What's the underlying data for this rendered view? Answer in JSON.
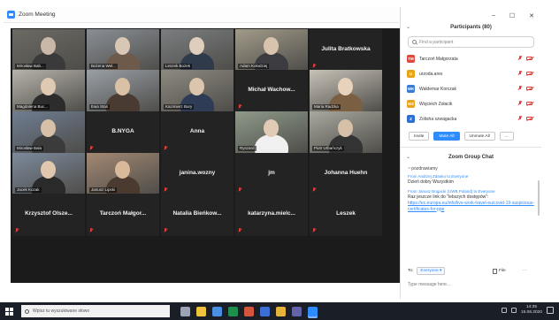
{
  "window": {
    "title": "Zoom Meeting"
  },
  "gallery": {
    "tiles": [
      {
        "name": "Mirosław Bab...",
        "type": "video"
      },
      {
        "name": "Bożena Wel...",
        "type": "video"
      },
      {
        "name": "Leszek Bożek",
        "type": "video"
      },
      {
        "name": "Adam Kołodziej",
        "type": "video",
        "active": true
      },
      {
        "name": "Julita Bratkowska",
        "type": "name"
      },
      {
        "name": "Magdalena Buc...",
        "type": "video"
      },
      {
        "name": "Ewa Staś",
        "type": "video"
      },
      {
        "name": "Kazimierz Bury",
        "type": "video"
      },
      {
        "name": "Michał Wachow...",
        "type": "name"
      },
      {
        "name": "Maria Radzka",
        "type": "video"
      },
      {
        "name": "Mirosław Bala",
        "type": "video"
      },
      {
        "name": "B.NYGA",
        "type": "name"
      },
      {
        "name": "Anna",
        "type": "name"
      },
      {
        "name": "Ryszard",
        "type": "video"
      },
      {
        "name": "Piotr Urbańczyk",
        "type": "video"
      },
      {
        "name": "Jacek Kozak",
        "type": "video"
      },
      {
        "name": "Janusz Lipski",
        "type": "video"
      },
      {
        "name": "janina.wozny",
        "type": "name"
      },
      {
        "name": "jm",
        "type": "name"
      },
      {
        "name": "Johanna Huehn",
        "type": "name"
      },
      {
        "name": "Krzysztof Olsze...",
        "type": "name"
      },
      {
        "name": "Tarczoń Małgor...",
        "type": "name"
      },
      {
        "name": "Natalia Bieńkow...",
        "type": "name"
      },
      {
        "name": "katarzyna.mielc...",
        "type": "name"
      },
      {
        "name": "Leszek",
        "type": "name"
      }
    ]
  },
  "participants": {
    "header": "Participants (80)",
    "collapse_glyph": "⌄",
    "search_placeholder": "Find a participant",
    "list": [
      {
        "initials": "TM",
        "name": "Tarczoń Małgorzata",
        "color": "#e0483e"
      },
      {
        "initials": "U",
        "name": "urzoda.ares",
        "color": "#e8a317"
      },
      {
        "initials": "WK",
        "name": "Waldemar Korczak",
        "color": "#3a7bd5"
      },
      {
        "initials": "WZ",
        "name": "Wojciech Zołacik",
        "color": "#e8a317"
      },
      {
        "initials": "Z",
        "name": "Zolisha szwagacka",
        "color": "#2d6fd1"
      }
    ],
    "buttons": {
      "invite": "Invite",
      "mute_all": "Mute All",
      "unmute_all": "Unmute All",
      "more": "..."
    }
  },
  "chat": {
    "header": "Zoom Group Chat",
    "messages": [
      {
        "from": "",
        "text": "~ pozdrawiamy"
      },
      {
        "from": "From Andrzej Zdanko to Everyone",
        "text": "Dzień dobry Wszystkim"
      },
      {
        "from": "From Janusz Bogacki (UWB Poland) to Everyone",
        "text": "Raz jeszcze link do \"lebszych dostępów\":",
        "link": "https://ec.europa.eu/info/live-work-travel-eu/covid-19-suspicious-certificates-for-ppe"
      }
    ],
    "to_label": "To:",
    "to_value": "Everyone ▾",
    "file_label": "File",
    "more_glyph": "···",
    "input_placeholder": "Type message here..."
  },
  "taskbar": {
    "search_placeholder": "Wpisz tu wyszukiwane słowo",
    "time": "14:35",
    "date": "15.06.2020",
    "apps": [
      {
        "name": "task-view",
        "color": "#9aa4b5"
      },
      {
        "name": "file-explorer",
        "color": "#f0c33c"
      },
      {
        "name": "store",
        "color": "#4a90e2"
      },
      {
        "name": "excel",
        "color": "#1f8f4e"
      },
      {
        "name": "powerpoint",
        "color": "#d2553c"
      },
      {
        "name": "word",
        "color": "#3b6fd6"
      },
      {
        "name": "chrome",
        "color": "#e6b33a"
      },
      {
        "name": "teams",
        "color": "#6264a7"
      },
      {
        "name": "zoom",
        "color": "#2d8cff"
      }
    ]
  }
}
